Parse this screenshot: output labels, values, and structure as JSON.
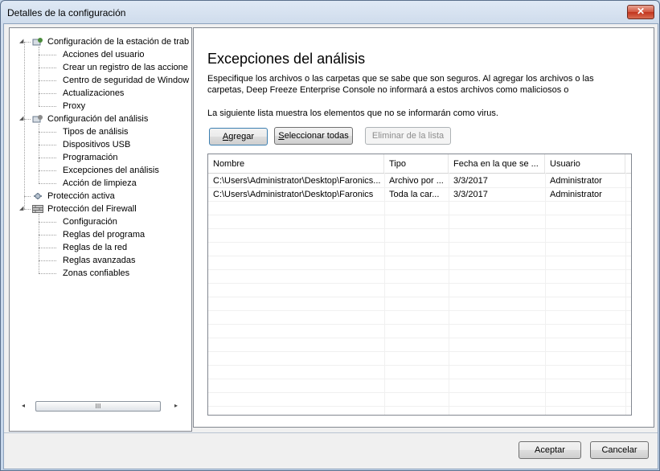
{
  "window": {
    "title": "Detalles de la configuración",
    "close_label": "✕"
  },
  "tree": {
    "items": [
      {
        "label": "Configuración de la estación de trab",
        "level": 0,
        "expanded": true,
        "icon": "workstation-config-icon"
      },
      {
        "label": "Acciones del usuario",
        "level": 1
      },
      {
        "label": "Crear un registro de las accione",
        "level": 1
      },
      {
        "label": "Centro de seguridad de Window",
        "level": 1
      },
      {
        "label": "Actualizaciones",
        "level": 1
      },
      {
        "label": "Proxy",
        "level": 1
      },
      {
        "label": "Configuración del análisis",
        "level": 0,
        "expanded": true,
        "icon": "scan-config-icon"
      },
      {
        "label": "Tipos de análisis",
        "level": 1
      },
      {
        "label": "Dispositivos USB",
        "level": 1
      },
      {
        "label": "Programación",
        "level": 1
      },
      {
        "label": "Excepciones del análisis",
        "level": 1
      },
      {
        "label": "Acción de limpieza",
        "level": 1
      },
      {
        "label": "Protección activa",
        "level": 0,
        "icon": "active-protection-icon"
      },
      {
        "label": "Protección del Firewall",
        "level": 0,
        "expanded": true,
        "icon": "firewall-icon"
      },
      {
        "label": "Configuración",
        "level": 1
      },
      {
        "label": "Reglas del  programa",
        "level": 1
      },
      {
        "label": "Reglas de la red",
        "level": 1
      },
      {
        "label": "Reglas avanzadas",
        "level": 1
      },
      {
        "label": "Zonas confiables",
        "level": 1
      }
    ],
    "scroll_left": "◂",
    "scroll_right": "▸",
    "scroll_grip": "III"
  },
  "main": {
    "heading": "Excepciones del análisis",
    "description": "Especifique los archivos o las carpetas que se sabe que son seguros. Al agregar los archivos o las carpetas, Deep Freeze Enterprise Console no informará a estos archivos como maliciosos o",
    "list_info": "La siguiente lista muestra los elementos que no se informarán como virus.",
    "buttons": {
      "add": "Agregar",
      "select_all": "Seleccionar todas",
      "remove": "Eliminar de la lista"
    },
    "columns": [
      "Nombre",
      "Tipo",
      "Fecha en la que se ...",
      "Usuario"
    ],
    "rows": [
      [
        "C:\\Users\\Administrator\\Desktop\\Faronics...",
        "Archivo por ...",
        "3/3/2017",
        "Administrator"
      ],
      [
        "C:\\Users\\Administrator\\Desktop\\Faronics",
        "Toda la car...",
        "3/3/2017",
        "Administrator"
      ]
    ]
  },
  "footer": {
    "ok": "Aceptar",
    "cancel": "Cancelar"
  }
}
